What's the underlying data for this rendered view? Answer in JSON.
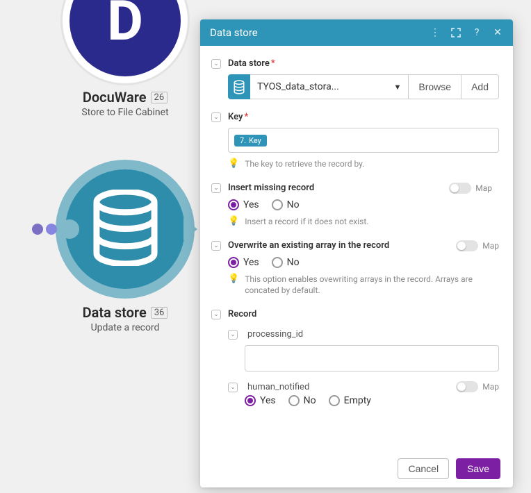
{
  "canvas": {
    "nodes": {
      "docuware": {
        "title": "DocuWare",
        "subtitle": "Store to File Cabinet",
        "badge": "26"
      },
      "datastore": {
        "title": "Data store",
        "subtitle": "Update a record",
        "badge": "36"
      }
    }
  },
  "panel": {
    "title": "Data store",
    "fields": {
      "data_store": {
        "label": "Data store",
        "value": "TYOS_data_stora...",
        "browse": "Browse",
        "add": "Add"
      },
      "key": {
        "label": "Key",
        "pill_num": "7.",
        "pill_text": "Key",
        "helper": "The key to retrieve the record by."
      },
      "insert_missing": {
        "label": "Insert missing record",
        "yes": "Yes",
        "no": "No",
        "helper": "Insert a record if it does not exist.",
        "map": "Map"
      },
      "overwrite": {
        "label": "Overwrite an existing array in the record",
        "yes": "Yes",
        "no": "No",
        "helper": "This option enables ovewriting arrays in the record. Arrays are concated by default.",
        "map": "Map"
      },
      "record": {
        "label": "Record",
        "processing_id": {
          "label": "processing_id",
          "value": ""
        },
        "human_notified": {
          "label": "human_notified",
          "yes": "Yes",
          "no": "No",
          "empty": "Empty",
          "map": "Map"
        }
      }
    },
    "footer": {
      "cancel": "Cancel",
      "save": "Save"
    }
  }
}
